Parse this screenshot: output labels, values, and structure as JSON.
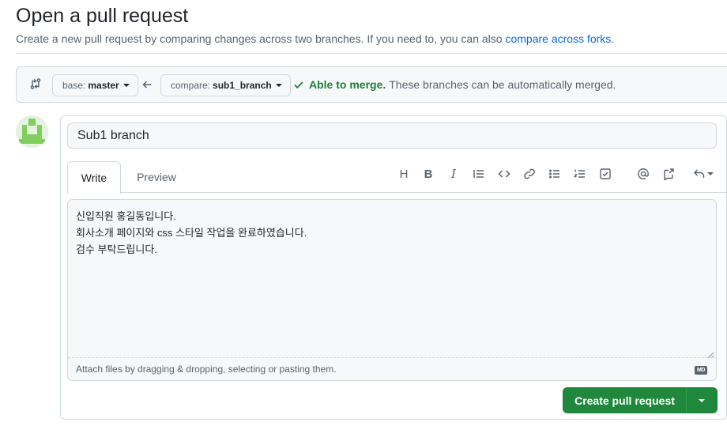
{
  "header": {
    "title": "Open a pull request",
    "subtitle_prefix": "Create a new pull request by comparing changes across two branches. If you need to, you can also ",
    "compare_forks_link": "compare across forks",
    "subtitle_suffix": "."
  },
  "compare": {
    "base_label": "base:",
    "base_value": "master",
    "compare_label": "compare:",
    "compare_value": "sub1_branch",
    "merge_ok": "Able to merge.",
    "merge_text": "These branches can be automatically merged."
  },
  "form": {
    "title_value": "Sub1 branch",
    "tabs": [
      "Write",
      "Preview"
    ],
    "toolbar_heading": "H",
    "toolbar_bold": "B",
    "toolbar_italic": "I",
    "body_value": "신입직원 홍길동입니다.\n회사소개 페이지와 css 스타일 작업을 완료하였습니다.\n검수 부탁드립니다.",
    "attach_hint": "Attach files by dragging & dropping, selecting or pasting them.",
    "markdown_badge": "MD",
    "submit_label": "Create pull request"
  },
  "colors": {
    "accent": "#1f883d",
    "link": "#0969da",
    "success": "#1a7f37"
  }
}
